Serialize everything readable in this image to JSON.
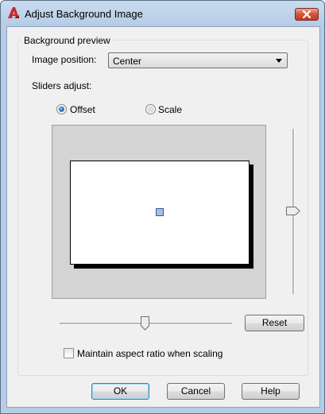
{
  "window": {
    "title": "Adjust Background Image"
  },
  "group": {
    "label": "Background preview"
  },
  "image_position": {
    "label": "Image position:",
    "value": "Center"
  },
  "sliders": {
    "label": "Sliders adjust:",
    "options": [
      "Offset",
      "Scale"
    ],
    "selected": "Offset"
  },
  "buttons": {
    "reset": "Reset",
    "ok": "OK",
    "cancel": "Cancel",
    "help": "Help"
  },
  "aspect_ratio": {
    "label": "Maintain aspect ratio when scaling",
    "checked": false
  },
  "colors": {
    "accent": "#3c7fb1",
    "close_button": "#c23b24"
  },
  "icons": {
    "app": "autocad-app-icon",
    "close": "close-icon",
    "dropdown": "chevron-down-icon"
  }
}
